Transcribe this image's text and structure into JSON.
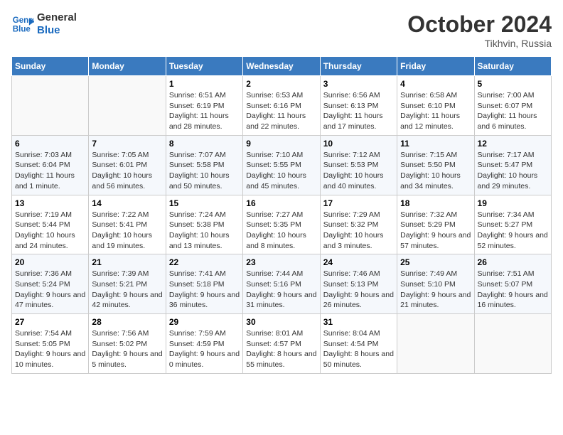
{
  "header": {
    "logo_line1": "General",
    "logo_line2": "Blue",
    "month": "October 2024",
    "location": "Tikhvin, Russia"
  },
  "weekdays": [
    "Sunday",
    "Monday",
    "Tuesday",
    "Wednesday",
    "Thursday",
    "Friday",
    "Saturday"
  ],
  "weeks": [
    [
      {
        "day": "",
        "info": ""
      },
      {
        "day": "",
        "info": ""
      },
      {
        "day": "1",
        "info": "Sunrise: 6:51 AM\nSunset: 6:19 PM\nDaylight: 11 hours and 28 minutes."
      },
      {
        "day": "2",
        "info": "Sunrise: 6:53 AM\nSunset: 6:16 PM\nDaylight: 11 hours and 22 minutes."
      },
      {
        "day": "3",
        "info": "Sunrise: 6:56 AM\nSunset: 6:13 PM\nDaylight: 11 hours and 17 minutes."
      },
      {
        "day": "4",
        "info": "Sunrise: 6:58 AM\nSunset: 6:10 PM\nDaylight: 11 hours and 12 minutes."
      },
      {
        "day": "5",
        "info": "Sunrise: 7:00 AM\nSunset: 6:07 PM\nDaylight: 11 hours and 6 minutes."
      }
    ],
    [
      {
        "day": "6",
        "info": "Sunrise: 7:03 AM\nSunset: 6:04 PM\nDaylight: 11 hours and 1 minute."
      },
      {
        "day": "7",
        "info": "Sunrise: 7:05 AM\nSunset: 6:01 PM\nDaylight: 10 hours and 56 minutes."
      },
      {
        "day": "8",
        "info": "Sunrise: 7:07 AM\nSunset: 5:58 PM\nDaylight: 10 hours and 50 minutes."
      },
      {
        "day": "9",
        "info": "Sunrise: 7:10 AM\nSunset: 5:55 PM\nDaylight: 10 hours and 45 minutes."
      },
      {
        "day": "10",
        "info": "Sunrise: 7:12 AM\nSunset: 5:53 PM\nDaylight: 10 hours and 40 minutes."
      },
      {
        "day": "11",
        "info": "Sunrise: 7:15 AM\nSunset: 5:50 PM\nDaylight: 10 hours and 34 minutes."
      },
      {
        "day": "12",
        "info": "Sunrise: 7:17 AM\nSunset: 5:47 PM\nDaylight: 10 hours and 29 minutes."
      }
    ],
    [
      {
        "day": "13",
        "info": "Sunrise: 7:19 AM\nSunset: 5:44 PM\nDaylight: 10 hours and 24 minutes."
      },
      {
        "day": "14",
        "info": "Sunrise: 7:22 AM\nSunset: 5:41 PM\nDaylight: 10 hours and 19 minutes."
      },
      {
        "day": "15",
        "info": "Sunrise: 7:24 AM\nSunset: 5:38 PM\nDaylight: 10 hours and 13 minutes."
      },
      {
        "day": "16",
        "info": "Sunrise: 7:27 AM\nSunset: 5:35 PM\nDaylight: 10 hours and 8 minutes."
      },
      {
        "day": "17",
        "info": "Sunrise: 7:29 AM\nSunset: 5:32 PM\nDaylight: 10 hours and 3 minutes."
      },
      {
        "day": "18",
        "info": "Sunrise: 7:32 AM\nSunset: 5:29 PM\nDaylight: 9 hours and 57 minutes."
      },
      {
        "day": "19",
        "info": "Sunrise: 7:34 AM\nSunset: 5:27 PM\nDaylight: 9 hours and 52 minutes."
      }
    ],
    [
      {
        "day": "20",
        "info": "Sunrise: 7:36 AM\nSunset: 5:24 PM\nDaylight: 9 hours and 47 minutes."
      },
      {
        "day": "21",
        "info": "Sunrise: 7:39 AM\nSunset: 5:21 PM\nDaylight: 9 hours and 42 minutes."
      },
      {
        "day": "22",
        "info": "Sunrise: 7:41 AM\nSunset: 5:18 PM\nDaylight: 9 hours and 36 minutes."
      },
      {
        "day": "23",
        "info": "Sunrise: 7:44 AM\nSunset: 5:16 PM\nDaylight: 9 hours and 31 minutes."
      },
      {
        "day": "24",
        "info": "Sunrise: 7:46 AM\nSunset: 5:13 PM\nDaylight: 9 hours and 26 minutes."
      },
      {
        "day": "25",
        "info": "Sunrise: 7:49 AM\nSunset: 5:10 PM\nDaylight: 9 hours and 21 minutes."
      },
      {
        "day": "26",
        "info": "Sunrise: 7:51 AM\nSunset: 5:07 PM\nDaylight: 9 hours and 16 minutes."
      }
    ],
    [
      {
        "day": "27",
        "info": "Sunrise: 7:54 AM\nSunset: 5:05 PM\nDaylight: 9 hours and 10 minutes."
      },
      {
        "day": "28",
        "info": "Sunrise: 7:56 AM\nSunset: 5:02 PM\nDaylight: 9 hours and 5 minutes."
      },
      {
        "day": "29",
        "info": "Sunrise: 7:59 AM\nSunset: 4:59 PM\nDaylight: 9 hours and 0 minutes."
      },
      {
        "day": "30",
        "info": "Sunrise: 8:01 AM\nSunset: 4:57 PM\nDaylight: 8 hours and 55 minutes."
      },
      {
        "day": "31",
        "info": "Sunrise: 8:04 AM\nSunset: 4:54 PM\nDaylight: 8 hours and 50 minutes."
      },
      {
        "day": "",
        "info": ""
      },
      {
        "day": "",
        "info": ""
      }
    ]
  ]
}
